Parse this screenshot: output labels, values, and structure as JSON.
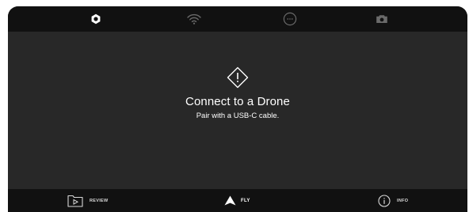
{
  "top_bar": {
    "items": [
      {
        "icon": "gear-icon",
        "active": true
      },
      {
        "icon": "wifi-icon",
        "active": false
      },
      {
        "icon": "more-icon",
        "active": false
      },
      {
        "icon": "camera-icon",
        "active": false
      }
    ]
  },
  "message": {
    "icon": "warning-icon",
    "title": "Connect to a Drone",
    "subtitle": "Pair with a USB-C cable."
  },
  "bottom_nav": {
    "review_label": "REVIEW",
    "fly_label": "FLY",
    "info_label": "INFO"
  },
  "colors": {
    "bar_background": "#111111",
    "panel_background": "#282828",
    "active_icon": "#ffffff",
    "inactive_icon": "#6a6a6a"
  }
}
